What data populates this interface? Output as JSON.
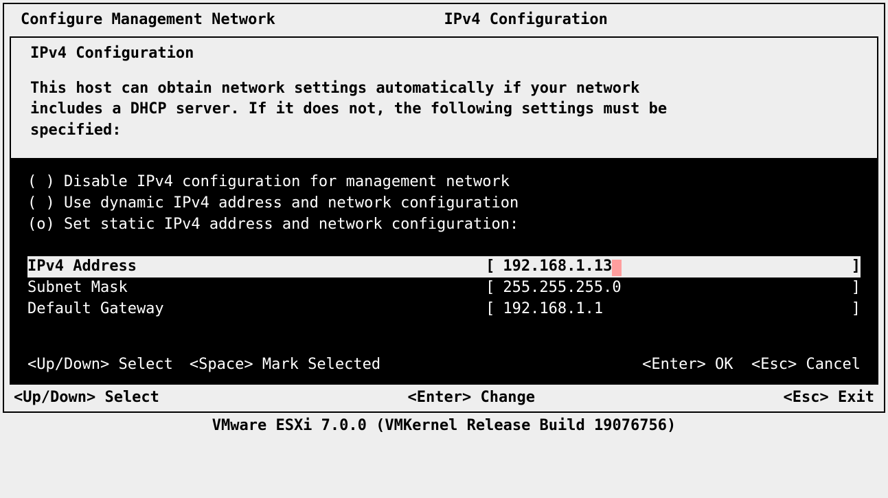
{
  "header": {
    "left": "Configure Management Network",
    "right": "IPv4 Configuration"
  },
  "dialog": {
    "title": "IPv4 Configuration",
    "description": "This host can obtain network settings automatically if your network\nincludes a DHCP server. If it does not, the following settings must be\nspecified:"
  },
  "options": {
    "disable": {
      "marker": "( )",
      "label": "Disable IPv4 configuration for management network"
    },
    "dynamic": {
      "marker": "( )",
      "label": "Use dynamic IPv4 address and network configuration"
    },
    "static": {
      "marker": "(o)",
      "label": "Set static IPv4 address and network configuration:"
    }
  },
  "fields": {
    "ipv4": {
      "label": "IPv4 Address",
      "value": "192.168.1.13",
      "active": true
    },
    "subnet": {
      "label": "Subnet Mask",
      "value": "255.255.255.0",
      "active": false
    },
    "gateway": {
      "label": "Default Gateway",
      "value": "192.168.1.1",
      "active": false
    }
  },
  "hints_inner": {
    "updown": "<Up/Down> Select",
    "space": "<Space> Mark Selected",
    "enter": "<Enter> OK",
    "esc": "<Esc> Cancel"
  },
  "hints_outer": {
    "updown": "<Up/Down> Select",
    "enter": "<Enter> Change",
    "esc": "<Esc> Exit"
  },
  "footer": "VMware ESXi 7.0.0 (VMKernel Release Build 19076756)"
}
